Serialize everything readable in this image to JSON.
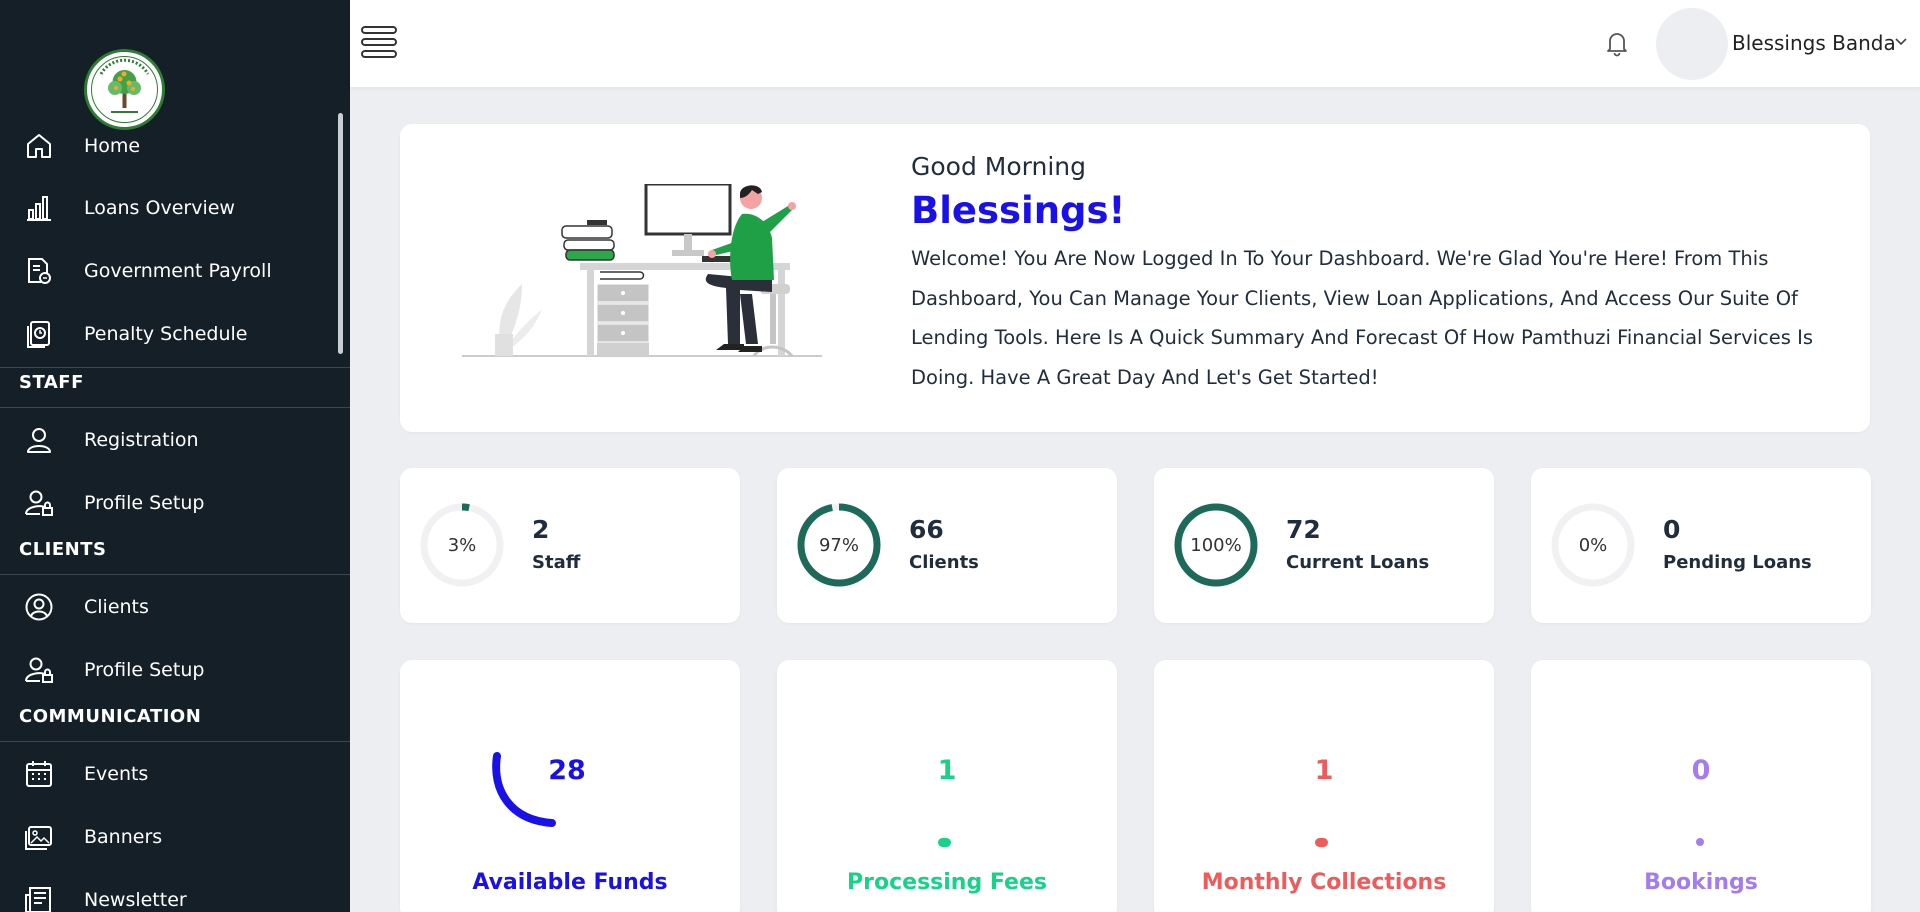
{
  "sidebar": {
    "items_main": [
      {
        "label": "Home",
        "icon": "home-icon"
      },
      {
        "label": "Loans Overview",
        "icon": "bar-chart-icon"
      },
      {
        "label": "Government Payroll",
        "icon": "payroll-document-icon"
      },
      {
        "label": "Penalty Schedule",
        "icon": "schedule-document-icon"
      }
    ],
    "sections": [
      {
        "title": "STAFF",
        "items": [
          {
            "label": "Registration",
            "icon": "user-icon"
          },
          {
            "label": "Profile Setup",
            "icon": "user-lock-icon"
          }
        ]
      },
      {
        "title": "CLIENTS",
        "items": [
          {
            "label": "Clients",
            "icon": "user-circle-icon"
          },
          {
            "label": "Profile Setup",
            "icon": "user-lock-icon"
          }
        ]
      },
      {
        "title": "COMMUNICATION",
        "items": [
          {
            "label": "Events",
            "icon": "calendar-icon"
          },
          {
            "label": "Banners",
            "icon": "image-icon"
          },
          {
            "label": "Newsletter",
            "icon": "newsletter-icon"
          }
        ]
      }
    ]
  },
  "topbar": {
    "user_name": "Blessings Banda"
  },
  "welcome": {
    "greeting": "Good Morning",
    "name": "Blessings!",
    "message": "Welcome! You Are Now Logged In To Your Dashboard. We're Glad You're Here! From This Dashboard, You Can Manage Your Clients, View Loan Applications, And Access Our Suite Of Lending Tools. Here Is A Quick Summary And Forecast Of How Pamthuzi Financial Services Is Doing. Have A Great Day And Let's Get Started!"
  },
  "stats": [
    {
      "percent": 3,
      "percent_label": "3%",
      "value": "2",
      "label": "Staff"
    },
    {
      "percent": 97,
      "percent_label": "97%",
      "value": "66",
      "label": "Clients"
    },
    {
      "percent": 100,
      "percent_label": "100%",
      "value": "72",
      "label": "Current Loans"
    },
    {
      "percent": 0,
      "percent_label": "0%",
      "value": "0",
      "label": "Pending Loans"
    }
  ],
  "funds": [
    {
      "value": "28",
      "label": "Available Funds",
      "color": "#1a10e8"
    },
    {
      "value": "1",
      "label": "Processing Fees",
      "color": "#16d388"
    },
    {
      "value": "1",
      "label": "Monthly Collections",
      "color": "#ef5b5b"
    },
    {
      "value": "0",
      "label": "Bookings",
      "color": "#a47cf0"
    }
  ],
  "colors": {
    "sidebar_bg": "#141f28",
    "accent": "#1a10e8",
    "ring": "#1e6a5a"
  }
}
